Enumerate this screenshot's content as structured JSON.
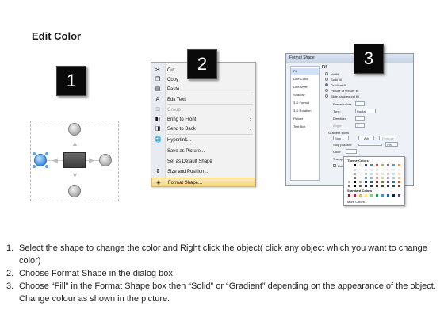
{
  "title": "Edit Color",
  "badges": [
    "1",
    "2",
    "3"
  ],
  "context_menu": {
    "items": [
      {
        "label": "Cut",
        "icon": "scissors-icon",
        "glyph": "✂",
        "disabled": false,
        "submenu": false
      },
      {
        "label": "Copy",
        "icon": "copy-icon",
        "glyph": "❐",
        "disabled": false,
        "submenu": false
      },
      {
        "label": "Paste",
        "icon": "paste-icon",
        "glyph": "▤",
        "disabled": false,
        "submenu": false
      },
      {
        "label": "Edit Text",
        "icon": "edit-text-icon",
        "glyph": "A",
        "disabled": false,
        "submenu": false
      },
      {
        "label": "Group",
        "icon": "group-icon",
        "glyph": "⊞",
        "disabled": true,
        "submenu": true
      },
      {
        "label": "Bring to Front",
        "icon": "bring-to-front-icon",
        "glyph": "◧",
        "disabled": false,
        "submenu": true
      },
      {
        "label": "Send to Back",
        "icon": "send-to-back-icon",
        "glyph": "◨",
        "disabled": false,
        "submenu": true
      },
      {
        "label": "Hyperlink...",
        "icon": "hyperlink-icon",
        "glyph": "🌐",
        "disabled": false,
        "submenu": false
      },
      {
        "label": "Save as Picture...",
        "icon": "",
        "glyph": "",
        "disabled": false,
        "submenu": false
      },
      {
        "label": "Set as Default Shape",
        "icon": "",
        "glyph": "",
        "disabled": false,
        "submenu": false
      },
      {
        "label": "Size and Position...",
        "icon": "size-position-icon",
        "glyph": "⇕",
        "disabled": false,
        "submenu": false
      },
      {
        "label": "Format Shape...",
        "icon": "format-shape-icon",
        "glyph": "◈",
        "disabled": false,
        "submenu": false,
        "highlighted": true
      }
    ]
  },
  "dialog": {
    "title": "Format Shape",
    "nav": [
      "Fill",
      "Line Color",
      "Line Style",
      "Shadow",
      "3-D Format",
      "3-D Rotation",
      "Picture",
      "Text Box"
    ],
    "section": "Fill",
    "options": [
      "No fill",
      "Solid fill",
      "Gradient fill",
      "Picture or texture fill",
      "Slide background fill"
    ],
    "selected_option": "Gradient fill",
    "labels": {
      "preset": "Preset colors:",
      "type": "Type:",
      "type_value": "Radial",
      "direction": "Direction:",
      "angle": "Angle:",
      "angle_value": "0°",
      "stops": "Gradient stops",
      "stop": "Stop 1",
      "add": "Add",
      "remove": "Remove",
      "stop_position": "Stop position:",
      "stop_value": "0%",
      "color": "Color:",
      "transparency": "Transpa",
      "rotate": "Rotate"
    }
  },
  "color_popup": {
    "theme_label": "Theme Colors",
    "standard_label": "Standard Colors",
    "more_label": "More Colors...",
    "theme_top": [
      "#ffffff",
      "#000000",
      "#eeece1",
      "#1f497d",
      "#4f81bd",
      "#c0504d",
      "#9bbb59",
      "#8064a2",
      "#4bacc6",
      "#f79646"
    ],
    "standard": [
      "#c00000",
      "#ff0000",
      "#ffc000",
      "#ffff00",
      "#92d050",
      "#00b050",
      "#00b0f0",
      "#0070c0",
      "#002060",
      "#7030a0"
    ]
  },
  "steps": [
    {
      "num": "1.",
      "text": "Select the shape to change the color and Right click the object( click any object which you want to change color)"
    },
    {
      "num": "2.",
      "text": "Choose Format Shape in the dialog box."
    },
    {
      "num": "3.",
      "text": "Choose “Fill” in the Format Shape box then “Solid” or “Gradient” depending on the appearance of the object. Change colour as shown in the picture."
    }
  ]
}
